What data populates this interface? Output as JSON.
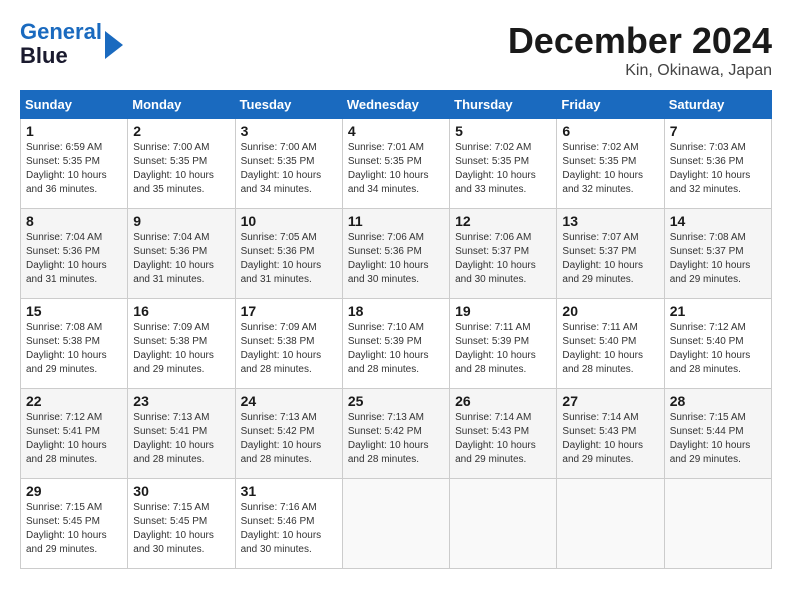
{
  "header": {
    "logo_line1": "General",
    "logo_line2": "Blue",
    "month_title": "December 2024",
    "location": "Kin, Okinawa, Japan"
  },
  "weekdays": [
    "Sunday",
    "Monday",
    "Tuesday",
    "Wednesday",
    "Thursday",
    "Friday",
    "Saturday"
  ],
  "weeks": [
    [
      {
        "day": 1,
        "sunrise": "6:59 AM",
        "sunset": "5:35 PM",
        "daylight": "10 hours and 36 minutes."
      },
      {
        "day": 2,
        "sunrise": "7:00 AM",
        "sunset": "5:35 PM",
        "daylight": "10 hours and 35 minutes."
      },
      {
        "day": 3,
        "sunrise": "7:00 AM",
        "sunset": "5:35 PM",
        "daylight": "10 hours and 34 minutes."
      },
      {
        "day": 4,
        "sunrise": "7:01 AM",
        "sunset": "5:35 PM",
        "daylight": "10 hours and 34 minutes."
      },
      {
        "day": 5,
        "sunrise": "7:02 AM",
        "sunset": "5:35 PM",
        "daylight": "10 hours and 33 minutes."
      },
      {
        "day": 6,
        "sunrise": "7:02 AM",
        "sunset": "5:35 PM",
        "daylight": "10 hours and 32 minutes."
      },
      {
        "day": 7,
        "sunrise": "7:03 AM",
        "sunset": "5:36 PM",
        "daylight": "10 hours and 32 minutes."
      }
    ],
    [
      {
        "day": 8,
        "sunrise": "7:04 AM",
        "sunset": "5:36 PM",
        "daylight": "10 hours and 31 minutes."
      },
      {
        "day": 9,
        "sunrise": "7:04 AM",
        "sunset": "5:36 PM",
        "daylight": "10 hours and 31 minutes."
      },
      {
        "day": 10,
        "sunrise": "7:05 AM",
        "sunset": "5:36 PM",
        "daylight": "10 hours and 31 minutes."
      },
      {
        "day": 11,
        "sunrise": "7:06 AM",
        "sunset": "5:36 PM",
        "daylight": "10 hours and 30 minutes."
      },
      {
        "day": 12,
        "sunrise": "7:06 AM",
        "sunset": "5:37 PM",
        "daylight": "10 hours and 30 minutes."
      },
      {
        "day": 13,
        "sunrise": "7:07 AM",
        "sunset": "5:37 PM",
        "daylight": "10 hours and 29 minutes."
      },
      {
        "day": 14,
        "sunrise": "7:08 AM",
        "sunset": "5:37 PM",
        "daylight": "10 hours and 29 minutes."
      }
    ],
    [
      {
        "day": 15,
        "sunrise": "7:08 AM",
        "sunset": "5:38 PM",
        "daylight": "10 hours and 29 minutes."
      },
      {
        "day": 16,
        "sunrise": "7:09 AM",
        "sunset": "5:38 PM",
        "daylight": "10 hours and 29 minutes."
      },
      {
        "day": 17,
        "sunrise": "7:09 AM",
        "sunset": "5:38 PM",
        "daylight": "10 hours and 28 minutes."
      },
      {
        "day": 18,
        "sunrise": "7:10 AM",
        "sunset": "5:39 PM",
        "daylight": "10 hours and 28 minutes."
      },
      {
        "day": 19,
        "sunrise": "7:11 AM",
        "sunset": "5:39 PM",
        "daylight": "10 hours and 28 minutes."
      },
      {
        "day": 20,
        "sunrise": "7:11 AM",
        "sunset": "5:40 PM",
        "daylight": "10 hours and 28 minutes."
      },
      {
        "day": 21,
        "sunrise": "7:12 AM",
        "sunset": "5:40 PM",
        "daylight": "10 hours and 28 minutes."
      }
    ],
    [
      {
        "day": 22,
        "sunrise": "7:12 AM",
        "sunset": "5:41 PM",
        "daylight": "10 hours and 28 minutes."
      },
      {
        "day": 23,
        "sunrise": "7:13 AM",
        "sunset": "5:41 PM",
        "daylight": "10 hours and 28 minutes."
      },
      {
        "day": 24,
        "sunrise": "7:13 AM",
        "sunset": "5:42 PM",
        "daylight": "10 hours and 28 minutes."
      },
      {
        "day": 25,
        "sunrise": "7:13 AM",
        "sunset": "5:42 PM",
        "daylight": "10 hours and 28 minutes."
      },
      {
        "day": 26,
        "sunrise": "7:14 AM",
        "sunset": "5:43 PM",
        "daylight": "10 hours and 29 minutes."
      },
      {
        "day": 27,
        "sunrise": "7:14 AM",
        "sunset": "5:43 PM",
        "daylight": "10 hours and 29 minutes."
      },
      {
        "day": 28,
        "sunrise": "7:15 AM",
        "sunset": "5:44 PM",
        "daylight": "10 hours and 29 minutes."
      }
    ],
    [
      {
        "day": 29,
        "sunrise": "7:15 AM",
        "sunset": "5:45 PM",
        "daylight": "10 hours and 29 minutes."
      },
      {
        "day": 30,
        "sunrise": "7:15 AM",
        "sunset": "5:45 PM",
        "daylight": "10 hours and 30 minutes."
      },
      {
        "day": 31,
        "sunrise": "7:16 AM",
        "sunset": "5:46 PM",
        "daylight": "10 hours and 30 minutes."
      },
      null,
      null,
      null,
      null
    ]
  ],
  "labels": {
    "sunrise": "Sunrise:",
    "sunset": "Sunset:",
    "daylight": "Daylight:"
  }
}
